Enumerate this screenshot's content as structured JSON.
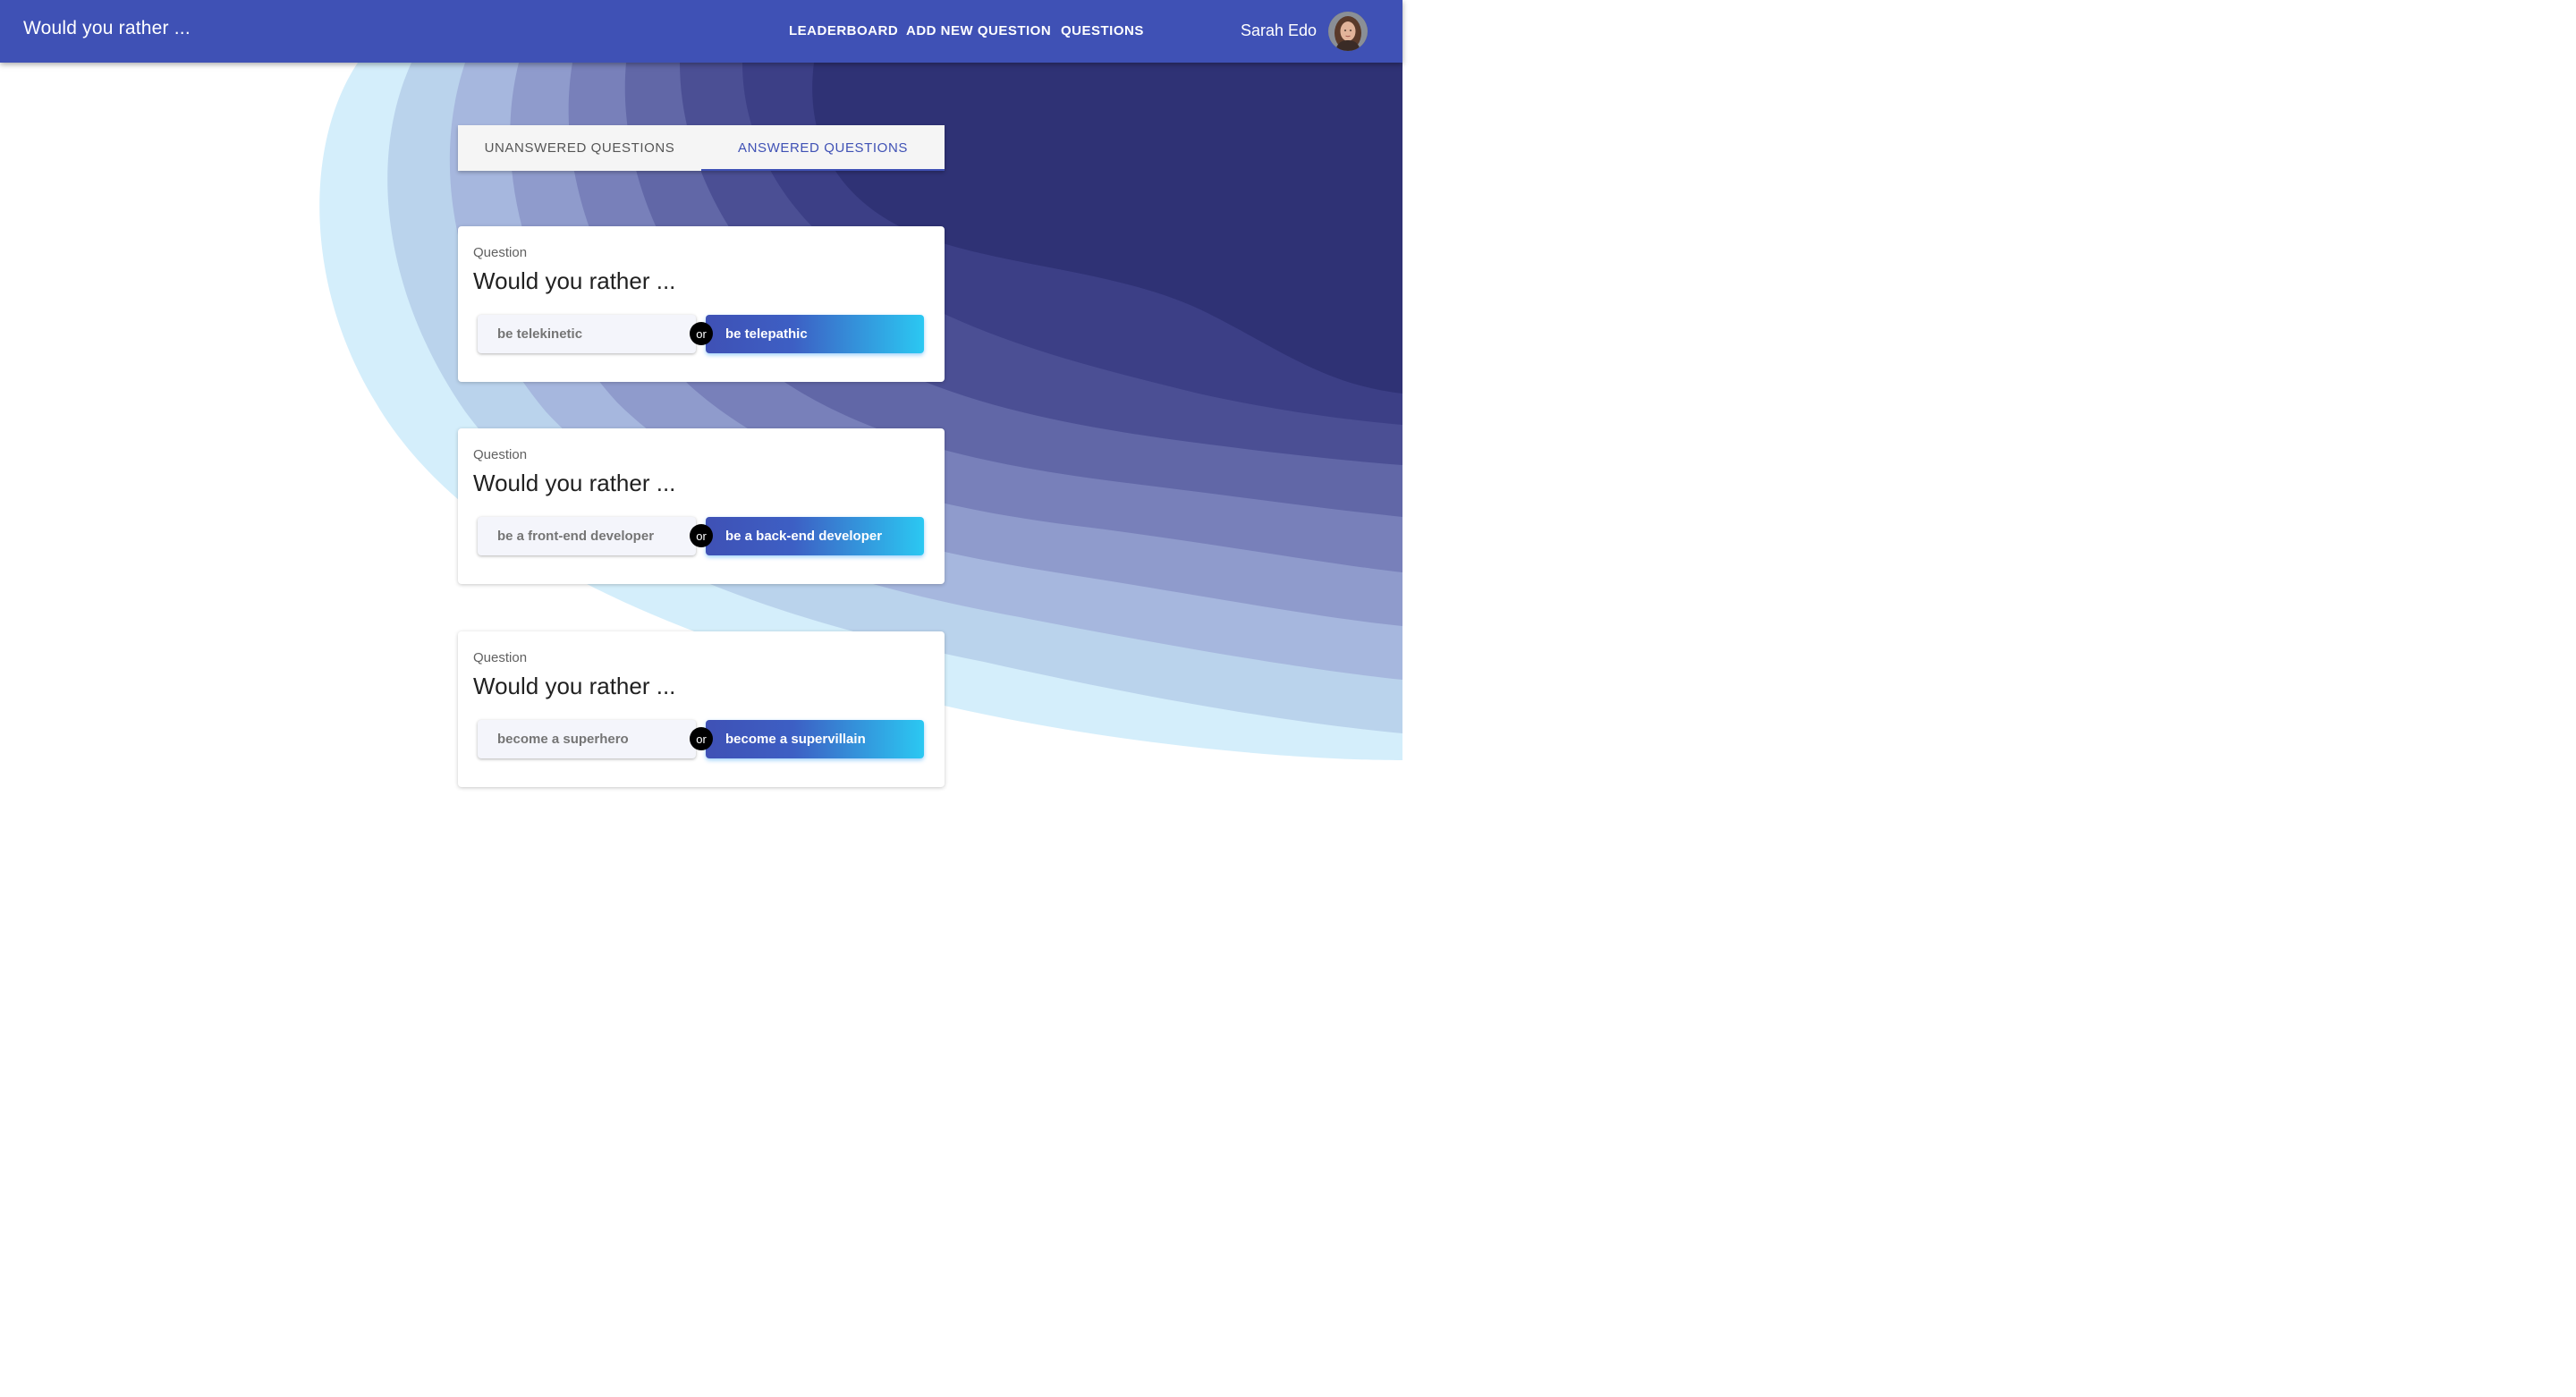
{
  "app": {
    "title": "Would you rather ..."
  },
  "nav": {
    "leaderboard": "LEADERBOARD",
    "add_new_question": "ADD NEW QUESTION",
    "questions": "QUESTIONS"
  },
  "user": {
    "name": "Sarah Edo"
  },
  "tabs": [
    {
      "label": "UNANSWERED QUESTIONS",
      "active": false
    },
    {
      "label": "ANSWERED QUESTIONS",
      "active": true
    }
  ],
  "questions": [
    {
      "label": "Question",
      "title": "Would you rather ...",
      "or": "or",
      "option_one": "be telekinetic",
      "option_two": "be telepathic"
    },
    {
      "label": "Question",
      "title": "Would you rather ...",
      "or": "or",
      "option_one": "be a front-end developer",
      "option_two": "be a back-end developer"
    },
    {
      "label": "Question",
      "title": "Would you rather ...",
      "or": "or",
      "option_one": "become a superhero",
      "option_two": "become a supervillain"
    }
  ],
  "colors": {
    "primary": "#3f51b5",
    "gradient_end": "#2bc8f2",
    "or_badge": "#000000",
    "wave_dark": "#2f3275",
    "wave_light": "#d6f0fb"
  }
}
